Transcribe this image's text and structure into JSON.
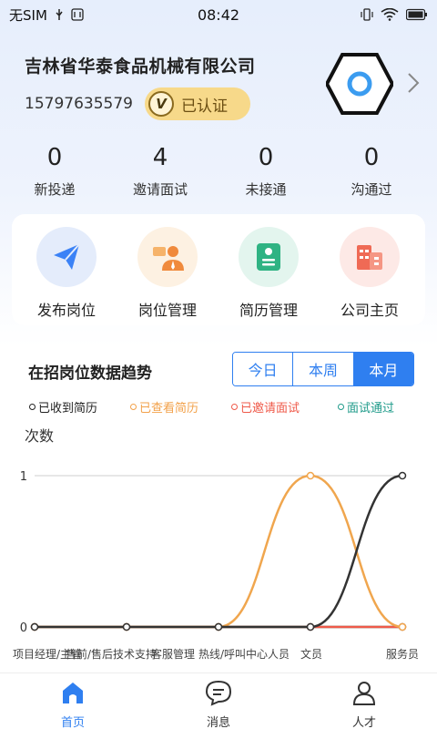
{
  "status_bar": {
    "carrier": "无SIM",
    "time": "08:42"
  },
  "company": {
    "name": "吉林省华泰食品机械有限公司",
    "phone": "15797635579",
    "verified_label": "已认证",
    "verified_icon_letter": "V"
  },
  "stats": [
    {
      "value": "0",
      "label": "新投递"
    },
    {
      "value": "4",
      "label": "邀请面试"
    },
    {
      "value": "0",
      "label": "未接通"
    },
    {
      "value": "0",
      "label": "沟通过"
    }
  ],
  "actions": [
    {
      "label": "发布岗位",
      "icon": "paper-plane-icon",
      "bg": "#e4ecfb",
      "color": "#3b82f6"
    },
    {
      "label": "岗位管理",
      "icon": "manager-icon",
      "bg": "#fdf1e2",
      "color": "#f08a3c"
    },
    {
      "label": "简历管理",
      "icon": "resume-icon",
      "bg": "#e3f5ee",
      "color": "#2fb383"
    },
    {
      "label": "公司主页",
      "icon": "building-icon",
      "bg": "#fde9e6",
      "color": "#ef6a55"
    }
  ],
  "chart_section": {
    "title": "在招岗位数据趋势",
    "tabs": [
      {
        "label": "今日",
        "active": false
      },
      {
        "label": "本周",
        "active": false
      },
      {
        "label": "本月",
        "active": true
      }
    ],
    "legend": [
      {
        "label": "已收到简历",
        "color": "#222222"
      },
      {
        "label": "已查看简历",
        "color": "#f2a14a"
      },
      {
        "label": "已邀请面试",
        "color": "#ef5a4a"
      },
      {
        "label": "面试通过",
        "color": "#1f9b8a"
      }
    ]
  },
  "chart_data": {
    "type": "line",
    "ylabel": "次数",
    "ylim": [
      0,
      1
    ],
    "yticks": [
      "0",
      "1"
    ],
    "x_labels": [
      "项目经理/主管",
      "售前/售后技术支持",
      "客服管理",
      "热线/呼叫中心人员",
      "文员",
      "服务员"
    ],
    "series": [
      {
        "name": "已收到简历",
        "color": "#333333",
        "values": [
          0,
          0,
          0,
          0,
          1
        ]
      },
      {
        "name": "已查看简历",
        "color": "#f0a64e",
        "values": [
          0,
          0,
          0,
          1,
          0
        ]
      },
      {
        "name": "已邀请面试",
        "color": "#ef5a4a",
        "values": [
          0,
          0,
          0,
          0,
          0
        ]
      },
      {
        "name": "面试通过",
        "color": "#1f8a7a",
        "values": [
          0,
          0,
          0,
          0,
          0
        ]
      }
    ]
  },
  "bottom_nav": [
    {
      "label": "首页",
      "icon": "home-icon",
      "active": true
    },
    {
      "label": "消息",
      "icon": "message-icon",
      "active": false
    },
    {
      "label": "人才",
      "icon": "person-icon",
      "active": false
    }
  ]
}
